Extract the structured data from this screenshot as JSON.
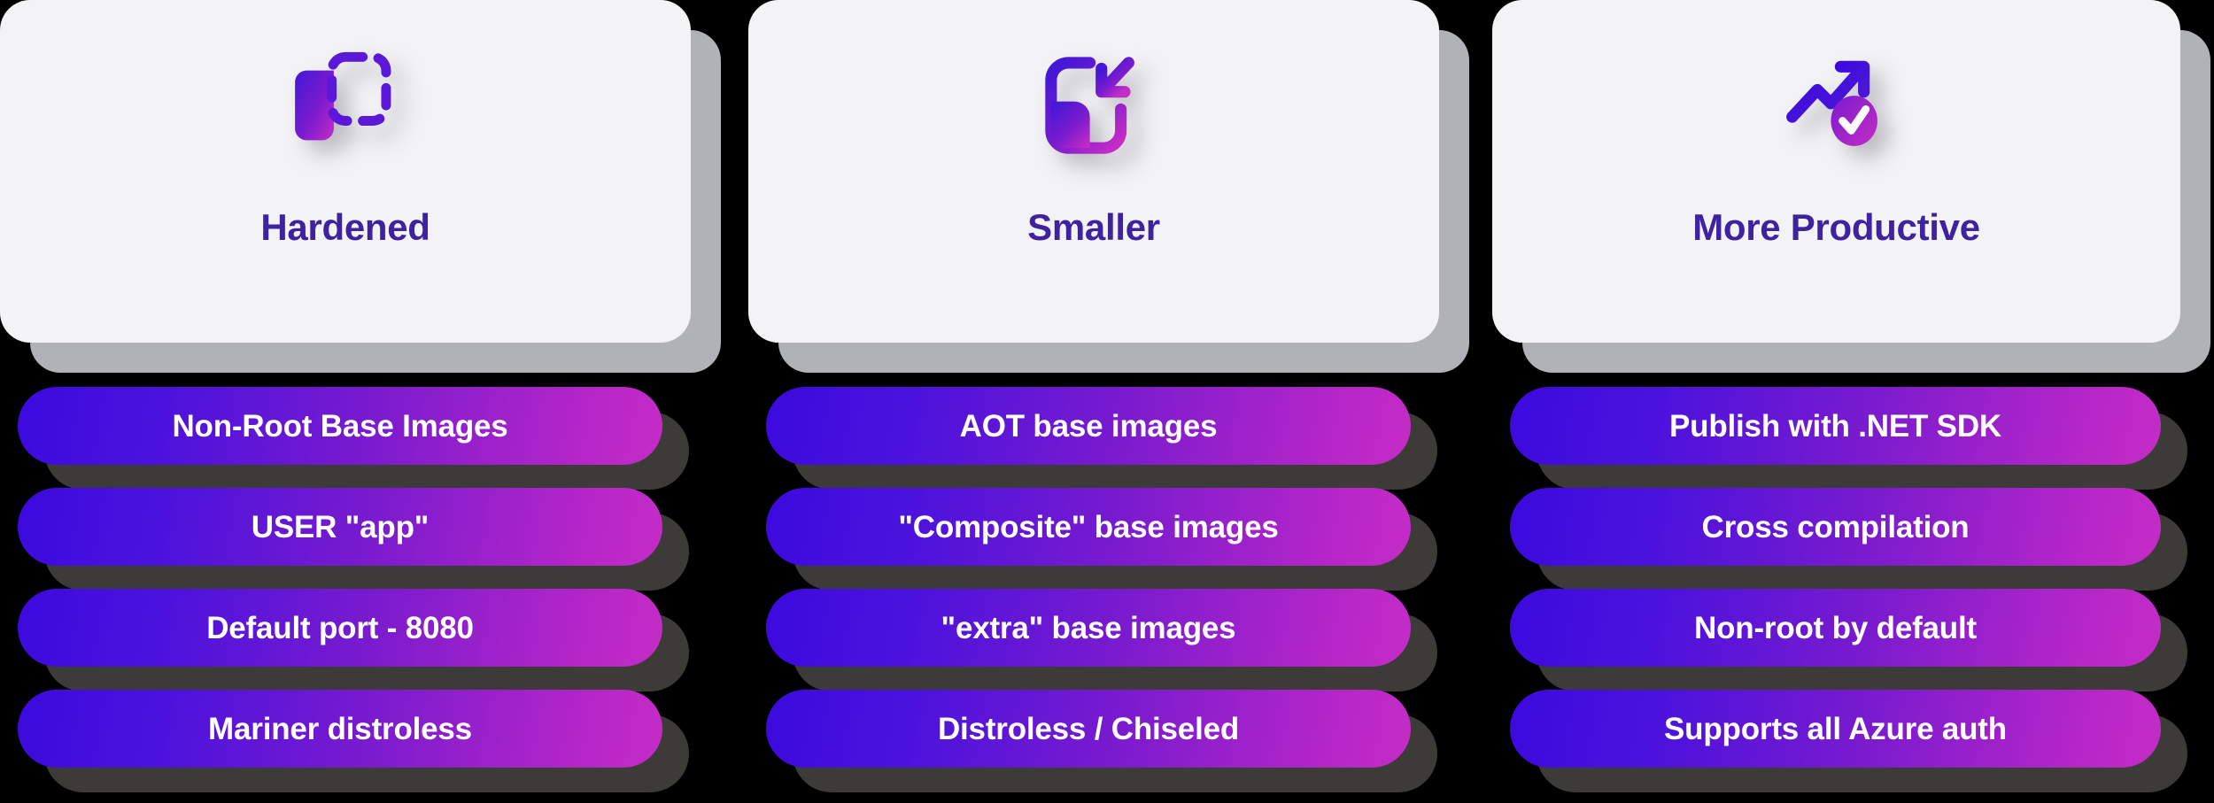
{
  "theme": {
    "card_bg": "#f3f3f5",
    "card_shadow": "#b0b2b6",
    "page_bg": "#000000",
    "title_color": "#3f22a0",
    "pill_gradient_start": "#3c0ade",
    "pill_gradient_end": "#c42cc6",
    "pill_shadow": "#3d3b38",
    "pill_label_color": "#ffffff"
  },
  "columns": [
    {
      "icon": "copy-dashed-outline-icon",
      "title": "Hardened",
      "pills": [
        {
          "label": "Non-Root Base Images"
        },
        {
          "label": "USER \"app\""
        },
        {
          "label": "Default port - 8080"
        },
        {
          "label": "Mariner distroless"
        }
      ]
    },
    {
      "icon": "collapse-arrow-inward-icon",
      "title": "Smaller",
      "pills": [
        {
          "label": "AOT base images"
        },
        {
          "label": "\"Composite\" base images"
        },
        {
          "label": "\"extra\" base images"
        },
        {
          "label": "Distroless / Chiseled"
        }
      ]
    },
    {
      "icon": "trending-up-check-icon",
      "title": "More Productive",
      "pills": [
        {
          "label": "Publish with .NET SDK"
        },
        {
          "label": "Cross compilation"
        },
        {
          "label": "Non-root by default"
        },
        {
          "label": "Supports all Azure auth"
        }
      ]
    }
  ]
}
